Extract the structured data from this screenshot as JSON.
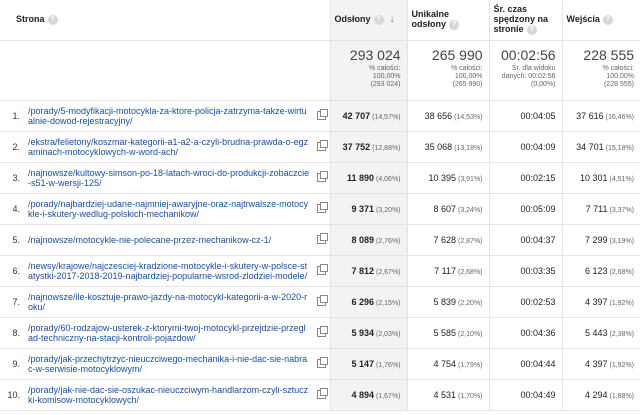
{
  "headers": {
    "page": "Strona",
    "views": "Odsłony",
    "unique": "Unikalne odsłony",
    "time": "Śr. czas spędzony na stronie",
    "entries": "Wejścia",
    "help_glyph": "?",
    "sort_glyph": "↓"
  },
  "totals": {
    "views": {
      "value": "293 024",
      "l1": "% całości:",
      "l2": "100,00%",
      "l3": "(293 024)"
    },
    "unique": {
      "value": "265 990",
      "l1": "% całości:",
      "l2": "100,00%",
      "l3": "(265 990)"
    },
    "time": {
      "value": "00:02:56",
      "l1": "Śr. dla widoku",
      "l2": "danych: 00:02:56",
      "l3": "(0,00%)"
    },
    "entries": {
      "value": "228 555",
      "l1": "% całości:",
      "l2": "100,00%",
      "l3": "(228 555)"
    }
  },
  "rows": [
    {
      "num": "1.",
      "page": "/porady/5-modyfikacji-motocykla-za-ktore-policja-zatrzyma-takze-wirtualnie-dowod-rejestracyjny/",
      "views": "42 707",
      "views_pct": "(14,57%)",
      "unique": "38 656",
      "unique_pct": "(14,53%)",
      "time": "00:04:05",
      "entries": "37 616",
      "entries_pct": "(16,46%)"
    },
    {
      "num": "2.",
      "page": "/ekstra/felietony/koszmar-kategorii-a1-a2-a-czyli-brudna-prawda-o-egzaminach-motocyklowych-w-word-ach/",
      "views": "37 752",
      "views_pct": "(12,88%)",
      "unique": "35 068",
      "unique_pct": "(13,18%)",
      "time": "00:04:09",
      "entries": "34 701",
      "entries_pct": "(15,18%)"
    },
    {
      "num": "3.",
      "page": "/najnowsze/kultowy-simson-po-18-latach-wroci-do-produkcji-zobaczcie-s51-w-wersji-125/",
      "views": "11 890",
      "views_pct": "(4,06%)",
      "unique": "10 395",
      "unique_pct": "(3,91%)",
      "time": "00:02:15",
      "entries": "10 301",
      "entries_pct": "(4,51%)"
    },
    {
      "num": "4.",
      "page": "/porady/najbardziej-udane-najmniej-awaryjne-oraz-najtrwalsze-motocykle-i-skutery-wedlug-polskich-mechanikow/",
      "views": "9 371",
      "views_pct": "(3,20%)",
      "unique": "8 607",
      "unique_pct": "(3,24%)",
      "time": "00:05:09",
      "entries": "7 711",
      "entries_pct": "(3,37%)"
    },
    {
      "num": "5.",
      "page": "/najnowsze/motocykle-nie-polecane-przez-mechanikow-cz-1/",
      "views": "8 089",
      "views_pct": "(2,76%)",
      "unique": "7 628",
      "unique_pct": "(2,87%)",
      "time": "00:04:37",
      "entries": "7 299",
      "entries_pct": "(3,19%)"
    },
    {
      "num": "6.",
      "page": "/newsy/krajowe/najczesciej-kradzione-motocykle-i-skutery-w-polsce-statystki-2017-2018-2019-najbardziej-popularne-wsrod-zlodziei-modele/",
      "views": "7 812",
      "views_pct": "(2,67%)",
      "unique": "7 117",
      "unique_pct": "(2,68%)",
      "time": "00:03:35",
      "entries": "6 123",
      "entries_pct": "(2,68%)"
    },
    {
      "num": "7.",
      "page": "/najnowsze/ile-kosztuje-prawo-jazdy-na-motocykl-kategorii-a-w-2020-roku/",
      "views": "6 296",
      "views_pct": "(2,15%)",
      "unique": "5 839",
      "unique_pct": "(2,20%)",
      "time": "00:02:53",
      "entries": "4 397",
      "entries_pct": "(1,92%)"
    },
    {
      "num": "8.",
      "page": "/porady/60-rodzajow-usterek-z-ktorymi-twoj-motocykl-przejdzie-przeglad-techniczny-na-stacji-kontroli-pojazdow/",
      "views": "5 934",
      "views_pct": "(2,03%)",
      "unique": "5 585",
      "unique_pct": "(2,10%)",
      "time": "00:04:36",
      "entries": "5 443",
      "entries_pct": "(2,38%)"
    },
    {
      "num": "9.",
      "page": "/porady/jak-przechytrzyc-nieuczciwego-mechanika-i-nie-dac-sie-nabrac-w-serwisie-motocyklowym/",
      "views": "5 147",
      "views_pct": "(1,76%)",
      "unique": "4 754",
      "unique_pct": "(1,79%)",
      "time": "00:04:44",
      "entries": "4 397",
      "entries_pct": "(1,92%)"
    },
    {
      "num": "10.",
      "page": "/porady/jak-nie-dac-sie-oszukac-nieuczciwym-handlarzom-czyli-sztuczki-komisow-motocyklowych/",
      "views": "4 894",
      "views_pct": "(1,67%)",
      "unique": "4 531",
      "unique_pct": "(1,70%)",
      "time": "00:04:49",
      "entries": "4 294",
      "entries_pct": "(1,88%)"
    }
  ]
}
